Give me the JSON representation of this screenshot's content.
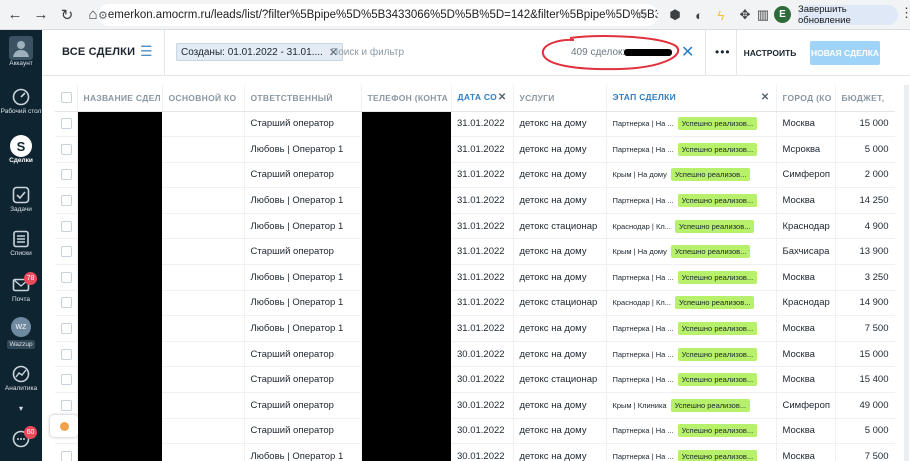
{
  "browser": {
    "url": "emerkon.amocrm.ru/leads/list/?filter%5Bpipe%5D%5B3433066%5D%5B%5D=142&filter%5Bpipe%5D%5B3433087%5D%5...",
    "update_label": "Завершить обновление",
    "profile_letter": "E"
  },
  "sidebar": {
    "items": [
      {
        "label": "Аккаунт",
        "icon": "account-icon"
      },
      {
        "label": "Рабочий стол",
        "icon": "dashboard-icon"
      },
      {
        "label": "Сделки",
        "icon": "deals-icon"
      },
      {
        "label": "Задачи",
        "icon": "tasks-icon"
      },
      {
        "label": "Списки",
        "icon": "lists-icon"
      },
      {
        "label": "Почта",
        "icon": "mail-icon",
        "badge": "78"
      },
      {
        "label": "Wazzup",
        "icon": "wazzup-icon",
        "avatar_text": "WZ"
      },
      {
        "label": "Аналитика",
        "icon": "analytics-icon"
      },
      {
        "label": "",
        "icon": "chat-icon",
        "badge": "60"
      }
    ]
  },
  "toolbar": {
    "title": "ВСЕ СДЕЛКИ",
    "filter_chip": "Созданы: 01.01.2022 - 31.01....",
    "search_placeholder": "Поиск и фильтр",
    "deal_count": "409 сделок:",
    "more_label": "•••",
    "setup_label": "НАСТРОИТЬ",
    "new_deal_label": "НОВАЯ СДЕЛКА"
  },
  "table": {
    "columns": [
      "НАЗВАНИЕ СДЕЛ",
      "ОСНОВНОЙ КО",
      "ОТВЕТСТВЕННЫЙ",
      "ТЕЛЕФОН (КОНТА",
      "ДАТА СО",
      "УСЛУГИ",
      "ЭТАП СДЕЛКИ",
      "ГОРОД (КО",
      "БЮДЖЕТ,"
    ],
    "rows": [
      {
        "resp": "Старший оператор",
        "date": "31.01.2022",
        "service": "детокс на дому",
        "pipeline": "Партнерка | На ...",
        "stage": "Успешно реализов...",
        "city": "Москва",
        "budget": "15 000"
      },
      {
        "resp": "Любовь | Оператор 1",
        "date": "31.01.2022",
        "service": "детокс на дому",
        "pipeline": "Партнерка | На ...",
        "stage": "Успешно реализов...",
        "city": "Мсроква",
        "budget": "5 000"
      },
      {
        "resp": "Старший оператор",
        "date": "31.01.2022",
        "service": "детокс на дому",
        "pipeline": "Крым | На дому",
        "stage": "Успешно реализов...",
        "city": "Симфероп",
        "budget": "2 000"
      },
      {
        "resp": "Любовь | Оператор 1",
        "date": "31.01.2022",
        "service": "детокс на дому",
        "pipeline": "Партнерка | На ...",
        "stage": "Успешно реализов...",
        "city": "Москва",
        "budget": "14 250"
      },
      {
        "resp": "Любовь | Оператор 1",
        "date": "31.01.2022",
        "service": "детокс стационар",
        "pipeline": "Краснодар | Кл...",
        "stage": "Успешно реализов...",
        "city": "Краснодар",
        "budget": "4 900"
      },
      {
        "resp": "Старший оператор",
        "date": "31.01.2022",
        "service": "детокс на дому",
        "pipeline": "Крым | На дому",
        "stage": "Успешно реализов...",
        "city": "Бахчисара",
        "budget": "13 900"
      },
      {
        "resp": "Любовь | Оператор 1",
        "date": "31.01.2022",
        "service": "детокс на дому",
        "pipeline": "Партнерка | На ...",
        "stage": "Успешно реализов...",
        "city": "Москва",
        "budget": "3 250"
      },
      {
        "resp": "Любовь | Оператор 1",
        "date": "31.01.2022",
        "service": "детокс стационар",
        "pipeline": "Краснодар | Кл...",
        "stage": "Успешно реализов...",
        "city": "Краснодар",
        "budget": "14 900"
      },
      {
        "resp": "Любовь | Оператор 1",
        "date": "31.01.2022",
        "service": "детокс на дому",
        "pipeline": "Партнерка | На ...",
        "stage": "Успешно реализов...",
        "city": "Москва",
        "budget": "7 500"
      },
      {
        "resp": "Старший оператор",
        "date": "30.01.2022",
        "service": "детокс на дому",
        "pipeline": "Партнерка | На ...",
        "stage": "Успешно реализов...",
        "city": "Москва",
        "budget": "15 000"
      },
      {
        "resp": "Старший оператор",
        "date": "30.01.2022",
        "service": "детокс стационар",
        "pipeline": "Партнерка | На ...",
        "stage": "Успешно реализов...",
        "city": "Москва",
        "budget": "15 400"
      },
      {
        "resp": "Старший оператор",
        "date": "30.01.2022",
        "service": "детокс на дому",
        "pipeline": "Крым | Клиника",
        "stage": "Успешно реализов...",
        "city": "Симфероп",
        "budget": "49 000"
      },
      {
        "resp": "Старший оператор",
        "date": "30.01.2022",
        "service": "детокс на дому",
        "pipeline": "Партнерка | На ...",
        "stage": "Успешно реализов...",
        "city": "Москва",
        "budget": "5 000"
      },
      {
        "resp": "Любовь | Оператор 1",
        "date": "30.01.2022",
        "service": "детокс на дому",
        "pipeline": "Партнерка | На ...",
        "stage": "Успешно реализов...",
        "city": "Москва",
        "budget": "7 500"
      }
    ]
  },
  "colors": {
    "sidebar_bg": "#0f2431",
    "accent_blue": "#2f7fc2",
    "stage_green": "#b7f06a",
    "new_deal_bg": "#9fd4f8"
  }
}
